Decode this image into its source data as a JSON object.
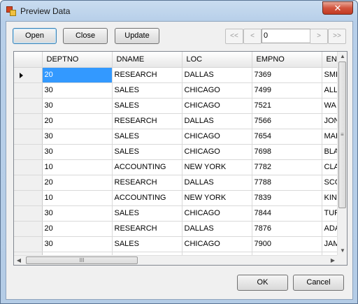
{
  "window": {
    "title": "Preview Data",
    "close_glyph": "✕"
  },
  "toolbar": {
    "open_label": "Open",
    "close_label": "Close",
    "update_label": "Update"
  },
  "navigator": {
    "first_glyph": "<<",
    "prev_glyph": "<",
    "position_value": "0",
    "next_glyph": ">",
    "last_glyph": ">>"
  },
  "grid": {
    "columns": [
      "DEPTNO",
      "DNAME",
      "LOC",
      "EMPNO",
      "EN"
    ],
    "rows": [
      [
        "20",
        "RESEARCH",
        "DALLAS",
        "7369",
        "SMI"
      ],
      [
        "30",
        "SALES",
        "CHICAGO",
        "7499",
        "ALL"
      ],
      [
        "30",
        "SALES",
        "CHICAGO",
        "7521",
        "WA"
      ],
      [
        "20",
        "RESEARCH",
        "DALLAS",
        "7566",
        "JON"
      ],
      [
        "30",
        "SALES",
        "CHICAGO",
        "7654",
        "MAF"
      ],
      [
        "30",
        "SALES",
        "CHICAGO",
        "7698",
        "BLA"
      ],
      [
        "10",
        "ACCOUNTING",
        "NEW YORK",
        "7782",
        "CLA"
      ],
      [
        "20",
        "RESEARCH",
        "DALLAS",
        "7788",
        "SCO"
      ],
      [
        "10",
        "ACCOUNTING",
        "NEW YORK",
        "7839",
        "KIN"
      ],
      [
        "30",
        "SALES",
        "CHICAGO",
        "7844",
        "TUF"
      ],
      [
        "20",
        "RESEARCH",
        "DALLAS",
        "7876",
        "ADA"
      ],
      [
        "30",
        "SALES",
        "CHICAGO",
        "7900",
        "JAM"
      ],
      [
        "",
        "",
        "",
        "",
        ""
      ]
    ],
    "selected_cell": "DEPTNO of first row",
    "vscroll_grip": "≡",
    "hscroll_grip": "III"
  },
  "footer": {
    "ok_label": "OK",
    "cancel_label": "Cancel"
  },
  "colors": {
    "selection": "#3399ff",
    "title_bar": "#b7cfe9",
    "close_button": "#c23a22"
  }
}
